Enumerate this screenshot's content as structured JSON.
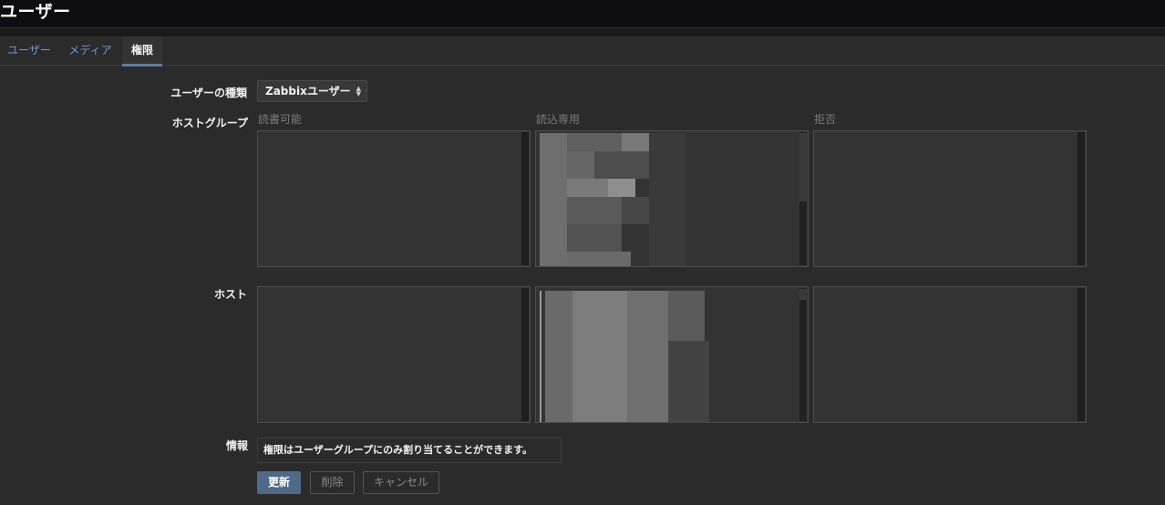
{
  "page": {
    "title": "ユーザー"
  },
  "tabs": [
    {
      "label": "ユーザー"
    },
    {
      "label": "メディア"
    },
    {
      "label": "権限"
    }
  ],
  "form": {
    "user_type_label": "ユーザーの種類",
    "user_type_value": "Zabbixユーザー",
    "host_groups_label": "ホストグループ",
    "hosts_label": "ホスト",
    "columns": {
      "read_write": "読書可能",
      "read_only": "読込専用",
      "deny": "拒否"
    },
    "info_label": "情報",
    "info_text": "権限はユーザーグループにのみ割り当てることができます。"
  },
  "buttons": {
    "update": "更新",
    "delete": "削除",
    "cancel": "キャンセル"
  },
  "colors": {
    "header_bg": "#0e0e12",
    "body_bg": "#2b2b2b",
    "tab_link": "#6b9bd0",
    "accent": "#607d9c",
    "primary_button": "#4f6a87"
  }
}
